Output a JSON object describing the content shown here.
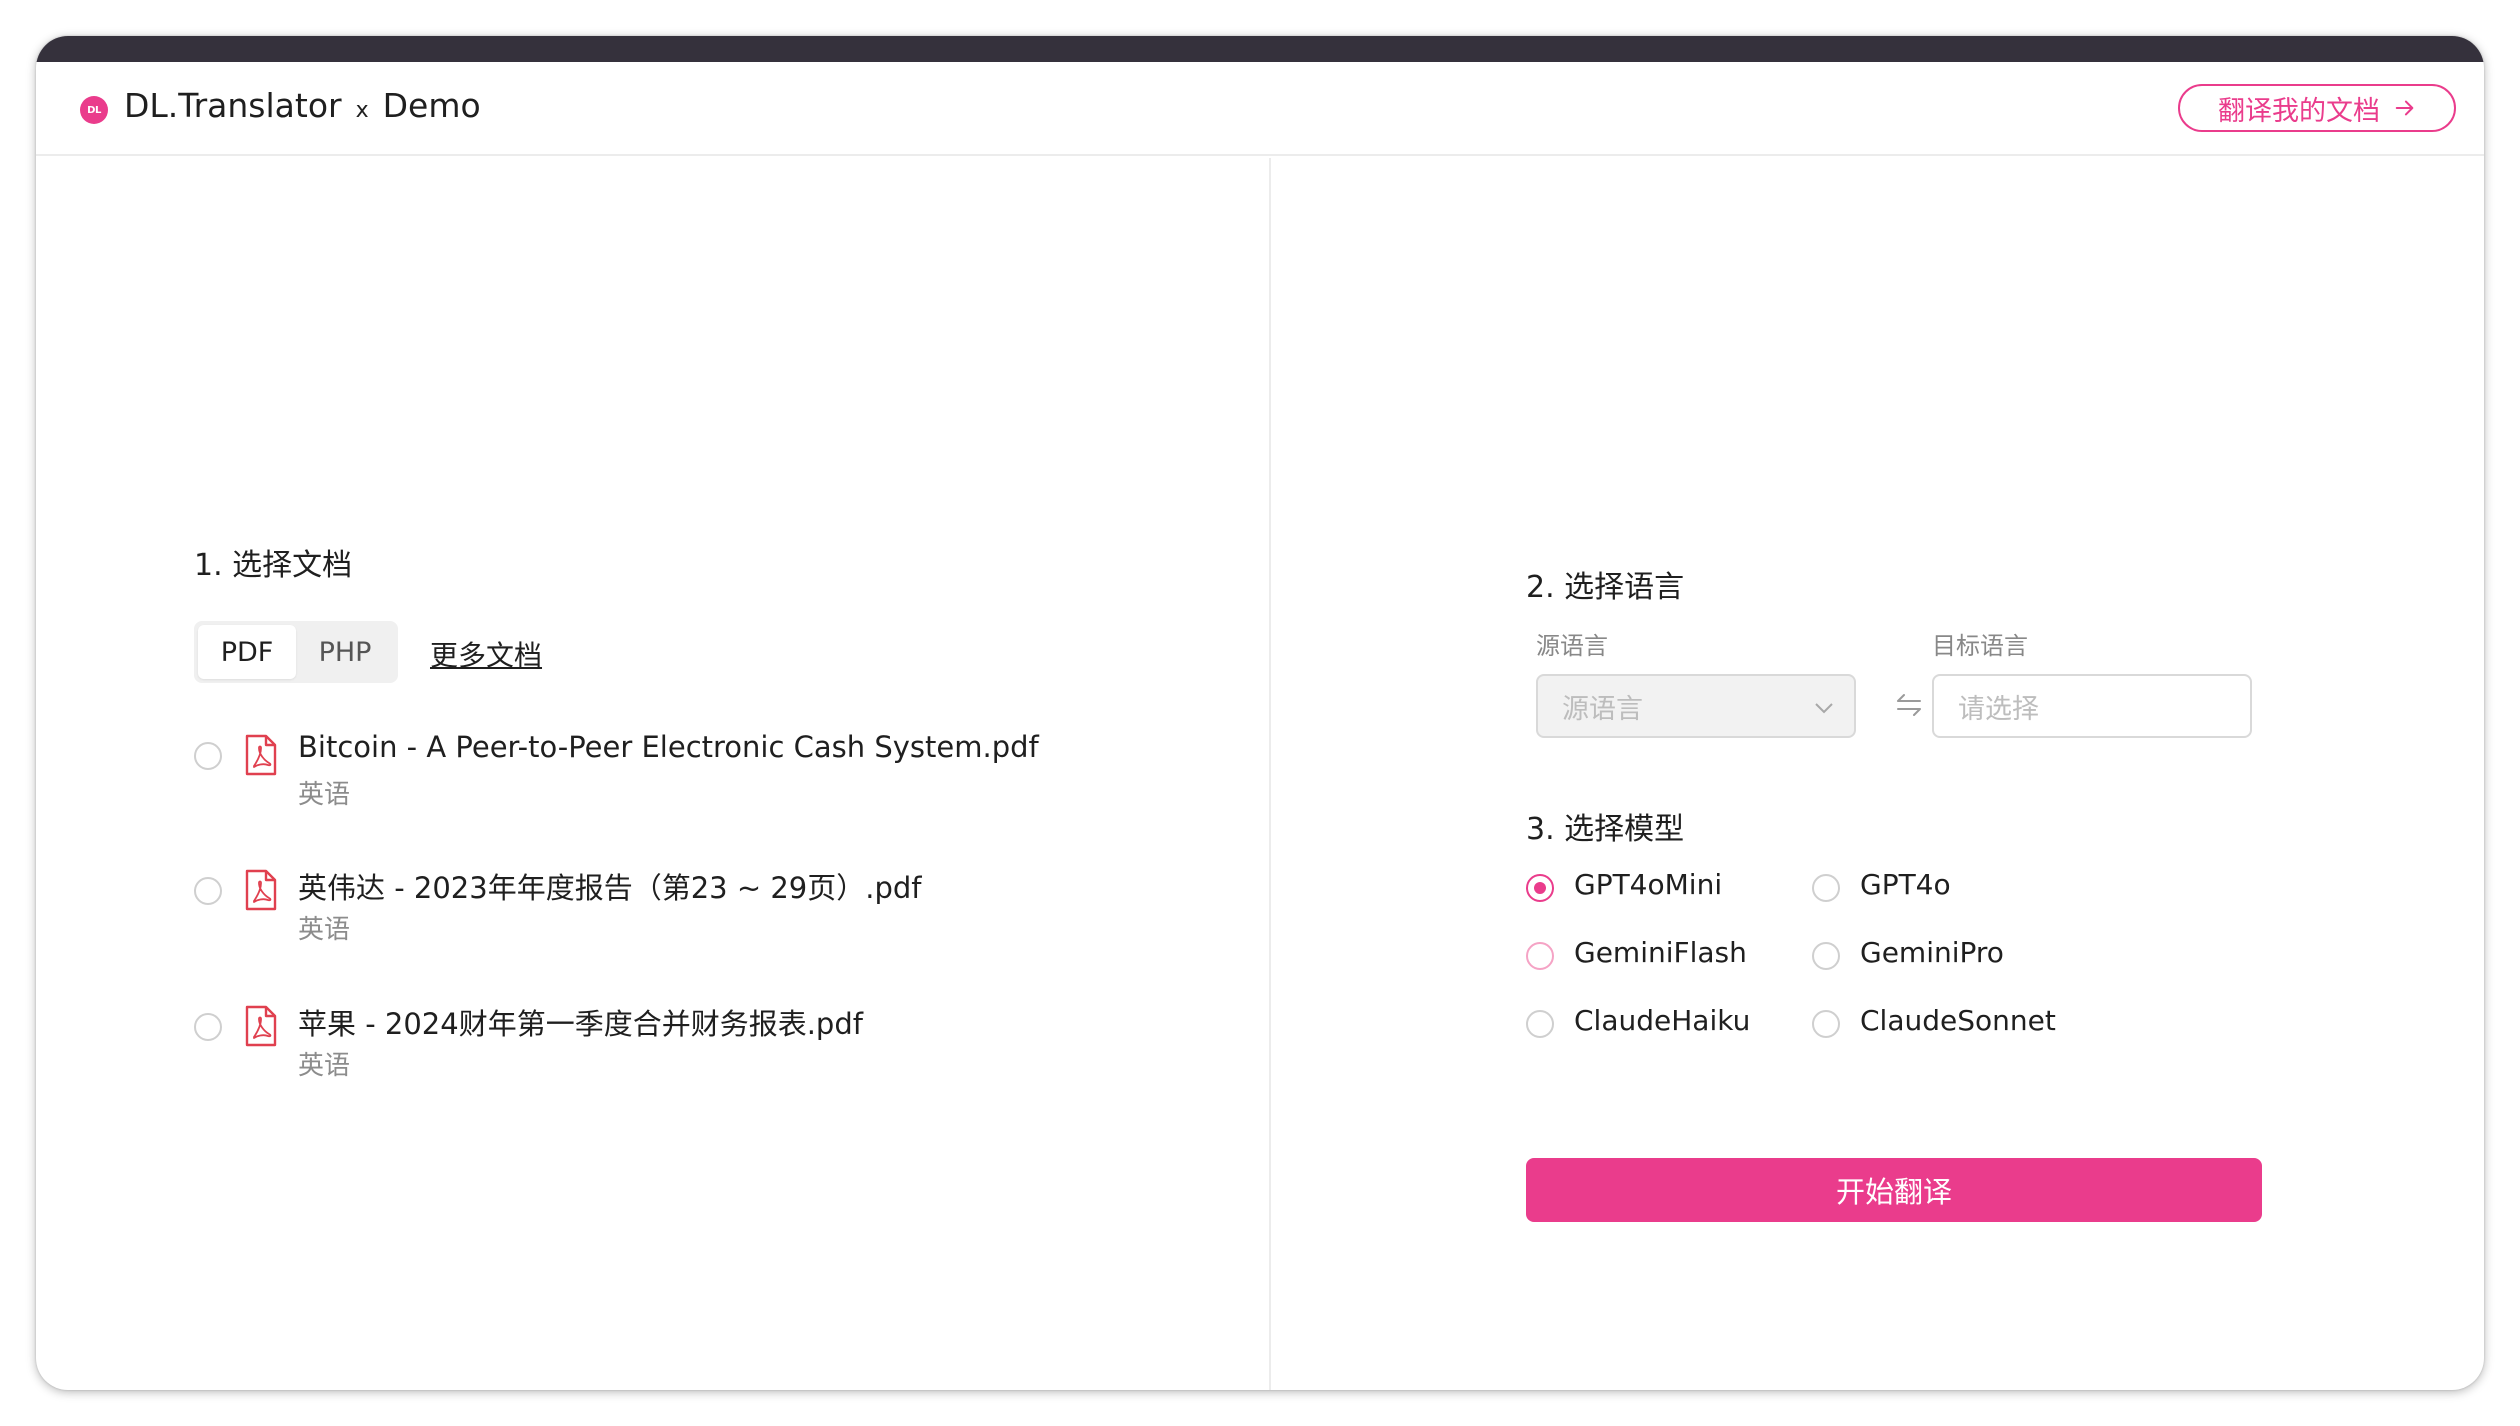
{
  "header": {
    "logo_text": "DL",
    "brand": "DL.Translator",
    "separator": "x",
    "demo": "Demo",
    "translate_my_doc": "翻译我的文档"
  },
  "documents": {
    "title": "1. 选择文档",
    "tabs": [
      "PDF",
      "PHP"
    ],
    "active_tab": "PDF",
    "more_link": "更多文档",
    "items": [
      {
        "name": "Bitcoin - A Peer-to-Peer Electronic Cash System.pdf",
        "lang": "英语",
        "selected": false
      },
      {
        "name": "英伟达 - 2023年年度报告（第23 ~ 29页）.pdf",
        "lang": "英语",
        "selected": false
      },
      {
        "name": "苹果 - 2024财年第一季度合并财务报表.pdf",
        "lang": "英语",
        "selected": false
      }
    ]
  },
  "language": {
    "title": "2. 选择语言",
    "source_label": "源语言",
    "source_placeholder": "源语言",
    "target_label": "目标语言",
    "target_placeholder": "请选择"
  },
  "model": {
    "title": "3. 选择模型",
    "options": [
      "GPT4oMini",
      "GPT4o",
      "GeminiFlash",
      "GeminiPro",
      "ClaudeHaiku",
      "ClaudeSonnet"
    ],
    "selected": "GPT4oMini"
  },
  "start_button": "开始翻译",
  "colors": {
    "accent": "#ea3c8c",
    "topbar": "#35313c"
  }
}
